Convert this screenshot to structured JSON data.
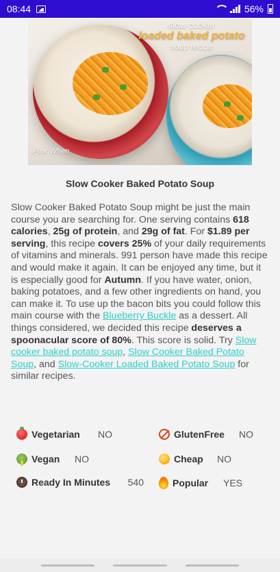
{
  "status_bar": {
    "time": "08:44",
    "battery": "56%",
    "icons": [
      "image-icon",
      "wifi-icon",
      "signal-icon",
      "battery-icon"
    ]
  },
  "hero": {
    "caption_line1": "slow cooker",
    "caption_line2": "loaded baked potato",
    "caption_line3": "soup recipe",
    "watermark": "Pink When"
  },
  "recipe": {
    "title": "Slow Cooker Baked Potato Soup",
    "summary": {
      "p1": "Slow Cooker Baked Potato Soup might be just the main course you are searching for. One serving contains ",
      "calories": "618 calories",
      "p2": ", ",
      "protein": "25g of protein",
      "p3": ", and ",
      "fat": "29g of fat",
      "p4": ". For ",
      "price": "$1.89 per serving",
      "p5": ", this recipe ",
      "covers": "covers 25%",
      "p6": " of your daily requirements of vitamins and minerals. 991 person have made this recipe and would make it again. It can be enjoyed any time, but it is especially good for ",
      "season": "Autumn",
      "p7": ". If you have water, onion, baking potatoes, and a few other ingredients on hand, you can make it. To use up the bacon bits you could follow this main course with the ",
      "link_dessert": "Blueberry Buckle",
      "p8": " as a dessert. All things considered, we decided this recipe ",
      "score": "deserves a spoonacular score of 80%",
      "p9": ". This score is solid. Try ",
      "link1": "Slow cooker baked potato soup",
      "p10": ", ",
      "link2": "Slow Cooker Baked Potato Soup",
      "p11": ", and ",
      "link3": "Slow-Cooker Loaded Baked Potato Soup",
      "p12": " for similar recipes."
    }
  },
  "properties": [
    {
      "icon": "tomato-icon",
      "label": "Vegetarian",
      "value": "NO"
    },
    {
      "icon": "no-gluten-icon",
      "label": "GlutenFree",
      "value": "NO"
    },
    {
      "icon": "broccoli-icon",
      "label": "Vegan",
      "value": "NO"
    },
    {
      "icon": "coin-icon",
      "label": "Cheap",
      "value": "NO"
    },
    {
      "icon": "clock-icon",
      "label": "Ready In Minutes",
      "value": "540"
    },
    {
      "icon": "fire-icon",
      "label": "Popular",
      "value": "YES"
    }
  ],
  "colors": {
    "status_bar": "#2f0ccf",
    "link": "#2ecfc7",
    "background": "#f3f3f3"
  }
}
